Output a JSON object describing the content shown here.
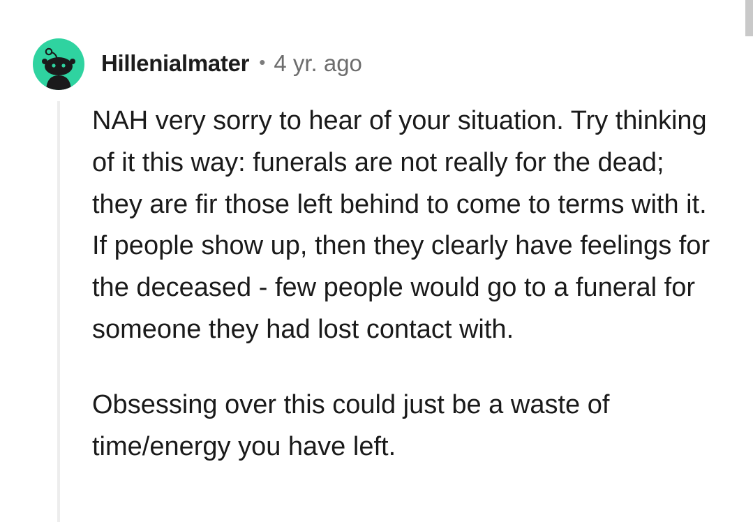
{
  "comment": {
    "author": "Hillenialmater",
    "separator": "•",
    "age": "4 yr. ago",
    "avatar_icon": "snoo-avatar-icon",
    "avatar_color": "#2fd3a0",
    "paragraphs": [
      "NAH very sorry to hear of your situation. Try thinking of it this way: funerals are not really for the dead; they are fir those left behind to come to terms with it. If people show up, then they clearly have feelings for the deceased - few people would go to a funeral for someone they had lost contact with.",
      "Obsessing over this could just be a waste of time/energy you have left."
    ]
  }
}
